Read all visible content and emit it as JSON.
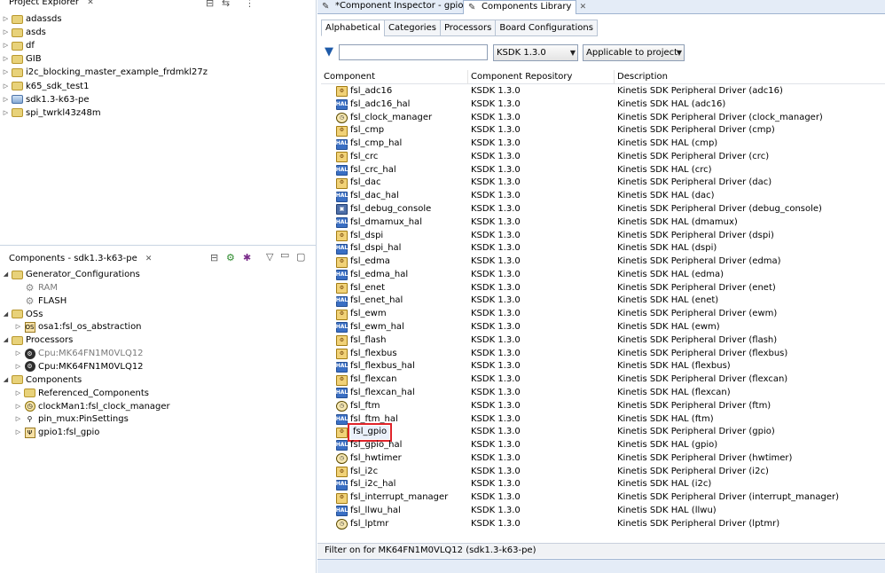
{
  "project_explorer": {
    "title": "Project Explorer",
    "items": [
      "adassds",
      "asds",
      "df",
      "GIB",
      "i2c_blocking_master_example_frdmkl27z",
      "k65_sdk_test1",
      "sdk1.3-k63-pe",
      "spi_twrkl43z48m"
    ]
  },
  "components_view": {
    "title": "Components - sdk1.3-k63-pe",
    "tree": [
      {
        "label": "Generator_Configurations",
        "level": 0,
        "icon": "folder-icon",
        "expanded": true
      },
      {
        "label": "RAM",
        "level": 1,
        "icon": "gear-icon",
        "dim": true
      },
      {
        "label": "FLASH",
        "level": 1,
        "icon": "gear-icon"
      },
      {
        "label": "OSs",
        "level": 0,
        "icon": "folder-icon",
        "expanded": true
      },
      {
        "label": "osa1:fsl_os_abstraction",
        "level": 1,
        "icon": "os-icon"
      },
      {
        "label": "Processors",
        "level": 0,
        "icon": "folder-icon",
        "expanded": true
      },
      {
        "label": "Cpu:MK64FN1M0VLQ12",
        "level": 1,
        "icon": "cpu-icon",
        "dim": true
      },
      {
        "label": "Cpu:MK64FN1M0VLQ12",
        "level": 1,
        "icon": "cpu-icon"
      },
      {
        "label": "Components",
        "level": 0,
        "icon": "folder-icon",
        "expanded": true
      },
      {
        "label": "Referenced_Components",
        "level": 1,
        "icon": "folder-icon"
      },
      {
        "label": "clockMan1:fsl_clock_manager",
        "level": 1,
        "icon": "clock-icon"
      },
      {
        "label": "pin_mux:PinSettings",
        "level": 1,
        "icon": "pin-icon"
      },
      {
        "label": "gpio1:fsl_gpio",
        "level": 1,
        "icon": "gpio-icon"
      }
    ]
  },
  "tabs": [
    {
      "label": "*Component Inspector - gpio1",
      "active": false
    },
    {
      "label": "Components Library",
      "active": true
    }
  ],
  "subtabs": [
    "Alphabetical",
    "Categories",
    "Processors",
    "Board Configurations"
  ],
  "filter": {
    "value": "",
    "sdk_select": "KSDK 1.3.0",
    "scope_select": "Applicable to project"
  },
  "columns": [
    "Component",
    "Component Repository",
    "Description"
  ],
  "rows": [
    {
      "name": "fsl_adc16",
      "repo": "KSDK 1.3.0",
      "desc": "Kinetis SDK Peripheral Driver (adc16)",
      "icon": "drv"
    },
    {
      "name": "fsl_adc16_hal",
      "repo": "KSDK 1.3.0",
      "desc": "Kinetis SDK HAL (adc16)",
      "icon": "hal"
    },
    {
      "name": "fsl_clock_manager",
      "repo": "KSDK 1.3.0",
      "desc": "Kinetis SDK Peripheral Driver (clock_manager)",
      "icon": "clk"
    },
    {
      "name": "fsl_cmp",
      "repo": "KSDK 1.3.0",
      "desc": "Kinetis SDK Peripheral Driver (cmp)",
      "icon": "drv"
    },
    {
      "name": "fsl_cmp_hal",
      "repo": "KSDK 1.3.0",
      "desc": "Kinetis SDK HAL (cmp)",
      "icon": "hal"
    },
    {
      "name": "fsl_crc",
      "repo": "KSDK 1.3.0",
      "desc": "Kinetis SDK Peripheral Driver (crc)",
      "icon": "drv"
    },
    {
      "name": "fsl_crc_hal",
      "repo": "KSDK 1.3.0",
      "desc": "Kinetis SDK HAL (crc)",
      "icon": "hal"
    },
    {
      "name": "fsl_dac",
      "repo": "KSDK 1.3.0",
      "desc": "Kinetis SDK Peripheral Driver (dac)",
      "icon": "drv"
    },
    {
      "name": "fsl_dac_hal",
      "repo": "KSDK 1.3.0",
      "desc": "Kinetis SDK HAL (dac)",
      "icon": "hal"
    },
    {
      "name": "fsl_debug_console",
      "repo": "KSDK 1.3.0",
      "desc": "Kinetis SDK Peripheral Driver (debug_console)",
      "icon": "cons"
    },
    {
      "name": "fsl_dmamux_hal",
      "repo": "KSDK 1.3.0",
      "desc": "Kinetis SDK HAL (dmamux)",
      "icon": "hal"
    },
    {
      "name": "fsl_dspi",
      "repo": "KSDK 1.3.0",
      "desc": "Kinetis SDK Peripheral Driver (dspi)",
      "icon": "drv"
    },
    {
      "name": "fsl_dspi_hal",
      "repo": "KSDK 1.3.0",
      "desc": "Kinetis SDK HAL (dspi)",
      "icon": "hal"
    },
    {
      "name": "fsl_edma",
      "repo": "KSDK 1.3.0",
      "desc": "Kinetis SDK Peripheral Driver (edma)",
      "icon": "drv"
    },
    {
      "name": "fsl_edma_hal",
      "repo": "KSDK 1.3.0",
      "desc": "Kinetis SDK HAL (edma)",
      "icon": "hal"
    },
    {
      "name": "fsl_enet",
      "repo": "KSDK 1.3.0",
      "desc": "Kinetis SDK Peripheral Driver (enet)",
      "icon": "drv"
    },
    {
      "name": "fsl_enet_hal",
      "repo": "KSDK 1.3.0",
      "desc": "Kinetis SDK HAL (enet)",
      "icon": "hal"
    },
    {
      "name": "fsl_ewm",
      "repo": "KSDK 1.3.0",
      "desc": "Kinetis SDK Peripheral Driver (ewm)",
      "icon": "drv"
    },
    {
      "name": "fsl_ewm_hal",
      "repo": "KSDK 1.3.0",
      "desc": "Kinetis SDK HAL (ewm)",
      "icon": "hal"
    },
    {
      "name": "fsl_flash",
      "repo": "KSDK 1.3.0",
      "desc": "Kinetis SDK Peripheral Driver (flash)",
      "icon": "drv"
    },
    {
      "name": "fsl_flexbus",
      "repo": "KSDK 1.3.0",
      "desc": "Kinetis SDK Peripheral Driver (flexbus)",
      "icon": "drv"
    },
    {
      "name": "fsl_flexbus_hal",
      "repo": "KSDK 1.3.0",
      "desc": "Kinetis SDK HAL (flexbus)",
      "icon": "hal"
    },
    {
      "name": "fsl_flexcan",
      "repo": "KSDK 1.3.0",
      "desc": "Kinetis SDK Peripheral Driver (flexcan)",
      "icon": "drv"
    },
    {
      "name": "fsl_flexcan_hal",
      "repo": "KSDK 1.3.0",
      "desc": "Kinetis SDK HAL (flexcan)",
      "icon": "hal"
    },
    {
      "name": "fsl_ftm",
      "repo": "KSDK 1.3.0",
      "desc": "Kinetis SDK Peripheral Driver (ftm)",
      "icon": "clk"
    },
    {
      "name": "fsl_ftm_hal",
      "repo": "KSDK 1.3.0",
      "desc": "Kinetis SDK HAL (ftm)",
      "icon": "hal"
    },
    {
      "name": "fsl_gpio",
      "repo": "KSDK 1.3.0",
      "desc": "Kinetis SDK Peripheral Driver (gpio)",
      "icon": "drv",
      "selected": true
    },
    {
      "name": "fsl_gpio_hal",
      "repo": "KSDK 1.3.0",
      "desc": "Kinetis SDK HAL (gpio)",
      "icon": "hal"
    },
    {
      "name": "fsl_hwtimer",
      "repo": "KSDK 1.3.0",
      "desc": "Kinetis SDK Peripheral Driver (hwtimer)",
      "icon": "clk"
    },
    {
      "name": "fsl_i2c",
      "repo": "KSDK 1.3.0",
      "desc": "Kinetis SDK Peripheral Driver (i2c)",
      "icon": "drv"
    },
    {
      "name": "fsl_i2c_hal",
      "repo": "KSDK 1.3.0",
      "desc": "Kinetis SDK HAL (i2c)",
      "icon": "hal"
    },
    {
      "name": "fsl_interrupt_manager",
      "repo": "KSDK 1.3.0",
      "desc": "Kinetis SDK Peripheral Driver (interrupt_manager)",
      "icon": "drv"
    },
    {
      "name": "fsl_llwu_hal",
      "repo": "KSDK 1.3.0",
      "desc": "Kinetis SDK HAL (llwu)",
      "icon": "hal"
    },
    {
      "name": "fsl_lptmr",
      "repo": "KSDK 1.3.0",
      "desc": "Kinetis SDK Peripheral Driver (lptmr)",
      "icon": "clk"
    }
  ],
  "status": "Filter on for MK64FN1M0VLQ12 (sdk1.3-k63-pe)"
}
